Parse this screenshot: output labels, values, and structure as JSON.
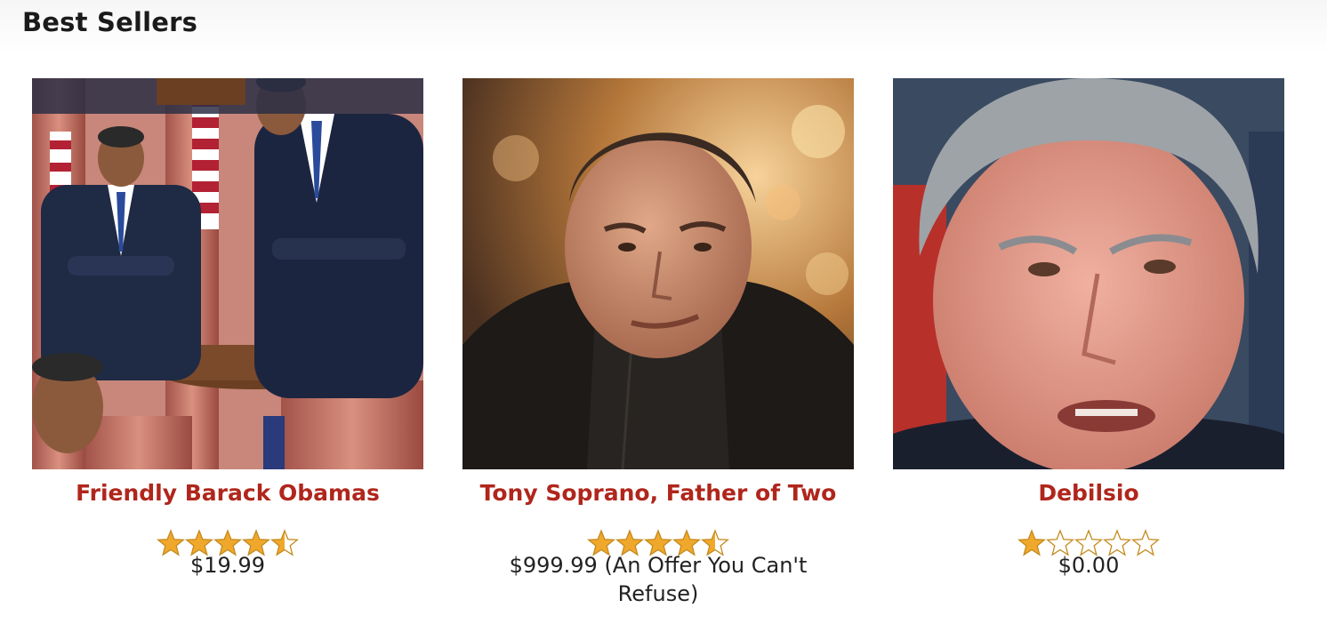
{
  "header": {
    "title": "Best Sellers"
  },
  "colors": {
    "accent": "#b0261c",
    "star_fill": "#f0a82c",
    "star_outline": "#c38a1c"
  },
  "products": [
    {
      "title": "Friendly Barack Obamas",
      "rating": 4.5,
      "rating_max": 5,
      "price": "$19.99",
      "image": "barack-obama-kaleidoscope-photo"
    },
    {
      "title": "Tony Soprano, Father of Two",
      "rating": 4.5,
      "rating_max": 5,
      "price": "$999.99 (An Offer You Can't Refuse)",
      "image": "tony-soprano-leather-jacket-photo"
    },
    {
      "title": "Debilsio",
      "rating": 1,
      "rating_max": 5,
      "price": "$0.00",
      "image": "bill-de-blasio-closeup-photo"
    }
  ]
}
